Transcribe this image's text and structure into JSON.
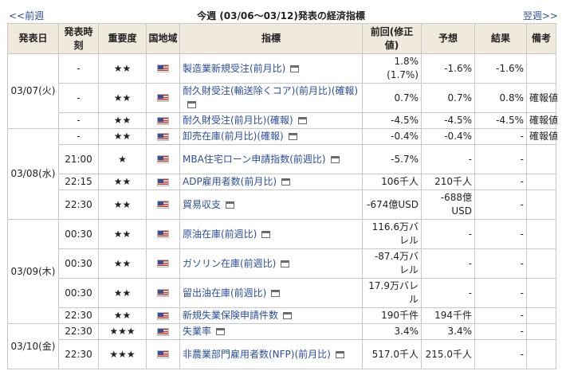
{
  "header": {
    "prev_label": "<<前週",
    "title": "今週 (03/06〜03/12)発表の経済指標",
    "next_label": "翌週>>"
  },
  "columns": {
    "date": "発表日",
    "time": "発表時刻",
    "importance": "重要度",
    "region": "国地域",
    "indicator": "指標",
    "previous": "前回(修正値)",
    "forecast": "予想",
    "result": "結果",
    "note": "備考"
  },
  "colors": {
    "link": "#2b4e9c",
    "header_bg": "#f0eadd",
    "border": "#c8c8c8"
  },
  "icons": {
    "region": "us-flag-icon",
    "detail": "window-icon"
  },
  "dates": [
    "03/07(火)",
    "03/08(水)",
    "03/09(木)",
    "03/10(金)"
  ],
  "rows": [
    {
      "time": "-",
      "importance": "★★",
      "indicator": "製造業新規受注(前月比)",
      "previous": "1.8%",
      "previous_revised": "(1.7%)",
      "forecast": "-1.6%",
      "result": "-1.6%",
      "note": ""
    },
    {
      "time": "-",
      "importance": "★★",
      "indicator": "耐久財受注(輸送除くコア)(前月比)(確報)",
      "previous": "0.7%",
      "previous_revised": "",
      "forecast": "0.7%",
      "result": "0.8%",
      "note": "確報値"
    },
    {
      "time": "-",
      "importance": "★★",
      "indicator": "耐久財受注(前月比)(確報)",
      "previous": "-4.5%",
      "previous_revised": "",
      "forecast": "-4.5%",
      "result": "-4.5%",
      "note": "確報値"
    },
    {
      "time": "-",
      "importance": "★★",
      "indicator": "卸売在庫(前月比)(確報)",
      "previous": "-0.4%",
      "previous_revised": "",
      "forecast": "-0.4%",
      "result": "-",
      "note": "確報値"
    },
    {
      "time": "21:00",
      "importance": "★",
      "indicator": "MBA住宅ローン申請指数(前週比)",
      "previous": "-5.7%",
      "previous_revised": "",
      "forecast": "-",
      "result": "-",
      "note": ""
    },
    {
      "time": "22:15",
      "importance": "★★",
      "indicator": "ADP雇用者数(前月比)",
      "previous": "106千人",
      "previous_revised": "",
      "forecast": "210千人",
      "result": "-",
      "note": ""
    },
    {
      "time": "22:30",
      "importance": "★★",
      "indicator": "貿易収支",
      "previous": "-674億USD",
      "previous_revised": "",
      "forecast": "-688億USD",
      "result": "-",
      "note": ""
    },
    {
      "time": "00:30",
      "importance": "★★",
      "indicator": "原油在庫(前週比)",
      "previous": "116.6万バレル",
      "previous_revised": "",
      "forecast": "-",
      "result": "-",
      "note": ""
    },
    {
      "time": "00:30",
      "importance": "★★",
      "indicator": "ガソリン在庫(前週比)",
      "previous": "-87.4万バレル",
      "previous_revised": "",
      "forecast": "-",
      "result": "-",
      "note": ""
    },
    {
      "time": "00:30",
      "importance": "★★",
      "indicator": "留出油在庫(前週比)",
      "previous": "17.9万バレル",
      "previous_revised": "",
      "forecast": "-",
      "result": "-",
      "note": ""
    },
    {
      "time": "22:30",
      "importance": "★★",
      "indicator": "新規失業保険申請件数",
      "previous": "190千件",
      "previous_revised": "",
      "forecast": "194千件",
      "result": "-",
      "note": ""
    },
    {
      "time": "22:30",
      "importance": "★★★",
      "indicator": "失業率",
      "previous": "3.4%",
      "previous_revised": "",
      "forecast": "3.4%",
      "result": "-",
      "note": ""
    },
    {
      "time": "22:30",
      "importance": "★★★",
      "indicator": "非農業部門雇用者数(NFP)(前月比)",
      "previous": "517.0千人",
      "previous_revised": "",
      "forecast": "215.0千人",
      "result": "-",
      "note": ""
    }
  ]
}
